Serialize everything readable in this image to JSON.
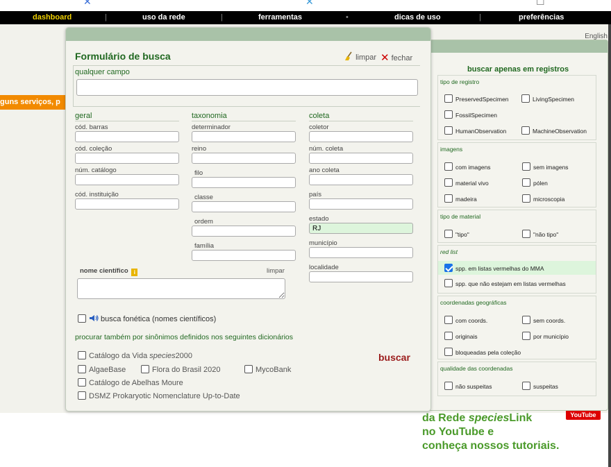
{
  "nav": {
    "items": [
      {
        "label": "dashboard",
        "active": true
      },
      {
        "label": "uso da rede"
      },
      {
        "label": "ferramentas"
      },
      {
        "label": "dicas de uso"
      },
      {
        "label": "preferências"
      }
    ],
    "dot": "•"
  },
  "page": {
    "english_link": "English",
    "orange_banner": "guns serviços, p",
    "promo_line1_pre": "da Rede ",
    "promo_line1_em": "species",
    "promo_line1_post": "Link",
    "promo_line2": "no YouTube e",
    "promo_line3": "conheça nossos tutoriais.",
    "youtube_badge": "YouTube"
  },
  "form": {
    "title": "Formulário de busca",
    "clear_label": "limpar",
    "close_label": "fechar",
    "any_field_label": "qualquer campo",
    "any_field_value": "",
    "columns": {
      "geral": {
        "heading": "geral",
        "fields": [
          {
            "label": "cód. barras",
            "value": ""
          },
          {
            "label": "cód. coleção",
            "value": ""
          },
          {
            "label": "núm. catálogo",
            "value": ""
          },
          {
            "label": "cód. instituição",
            "value": ""
          }
        ]
      },
      "taxonomia": {
        "heading": "taxonomia",
        "fields": [
          {
            "label": "determinador",
            "value": ""
          },
          {
            "label": "reino",
            "value": ""
          },
          {
            "label": "filo",
            "value": ""
          },
          {
            "label": "classe",
            "value": ""
          },
          {
            "label": "ordem",
            "value": ""
          },
          {
            "label": "família",
            "value": ""
          }
        ]
      },
      "coleta": {
        "heading": "coleta",
        "fields": [
          {
            "label": "coletor",
            "value": ""
          },
          {
            "label": "núm. coleta",
            "value": ""
          },
          {
            "label": "ano coleta",
            "value": ""
          },
          {
            "label": "país",
            "value": ""
          },
          {
            "label": "estado",
            "value": "RJ"
          },
          {
            "label": "município",
            "value": ""
          },
          {
            "label": "localidade",
            "value": ""
          }
        ]
      }
    },
    "scientific_name_label": "nome científico",
    "scientific_name_info": "i",
    "scientific_name_clear": "limpar",
    "phonetic_label": "busca fonética (nomes científicos)",
    "phonetic_checked": false,
    "synonyms_heading": "procurar também por sinônimos definidos nos seguintes dicionários",
    "dictionaries": {
      "catalogo_vida_pre": "Catálogo da Vida ",
      "catalogo_vida_em": "species",
      "catalogo_vida_post": "2000",
      "algaebase": "AlgaeBase",
      "flora_brasil": "Flora do Brasil 2020",
      "mycobank": "MycoBank",
      "abelhas_moure": "Catálogo de Abelhas Moure",
      "dsmz": "DSMZ Prokaryotic Nomenclature Up-to-Date"
    },
    "search_button": "buscar"
  },
  "filters": {
    "title": "buscar apenas em registros",
    "tipo_registro": {
      "label": "tipo de registro",
      "options": [
        "PreservedSpecimen",
        "LivingSpecimen",
        "FossilSpecimen",
        "HumanObservation",
        "MachineObservation"
      ]
    },
    "imagens": {
      "label": "imagens",
      "options": [
        "com imagens",
        "sem imagens",
        "material vivo",
        "pólen",
        "madeira",
        "microscopia"
      ]
    },
    "tipo_material": {
      "label": "tipo de material",
      "options": [
        "\"tipo\"",
        "\"não tipo\""
      ]
    },
    "red_list": {
      "label": "red list",
      "options": [
        {
          "label": "spp. em listas vermelhas do MMA",
          "checked": true
        },
        {
          "label": "spp. que não estejam em listas vermelhas",
          "checked": false
        }
      ]
    },
    "coordenadas": {
      "label": "coordenadas geográficas",
      "options": [
        "com coords.",
        "sem coords.",
        "originais",
        "por município",
        "bloqueadas pela coleção"
      ]
    },
    "qualidade": {
      "label": "qualidade das coordenadas",
      "options": [
        "não suspeitas",
        "suspeitas"
      ]
    }
  },
  "colors": {
    "nav_bg": "#000000",
    "nav_active": "#f0d000",
    "header_bar": "#a9c2a8",
    "section_green": "#206820",
    "search_red": "#9b1c1c",
    "highlight": "#ddf5dc",
    "orange": "#f28a00"
  }
}
